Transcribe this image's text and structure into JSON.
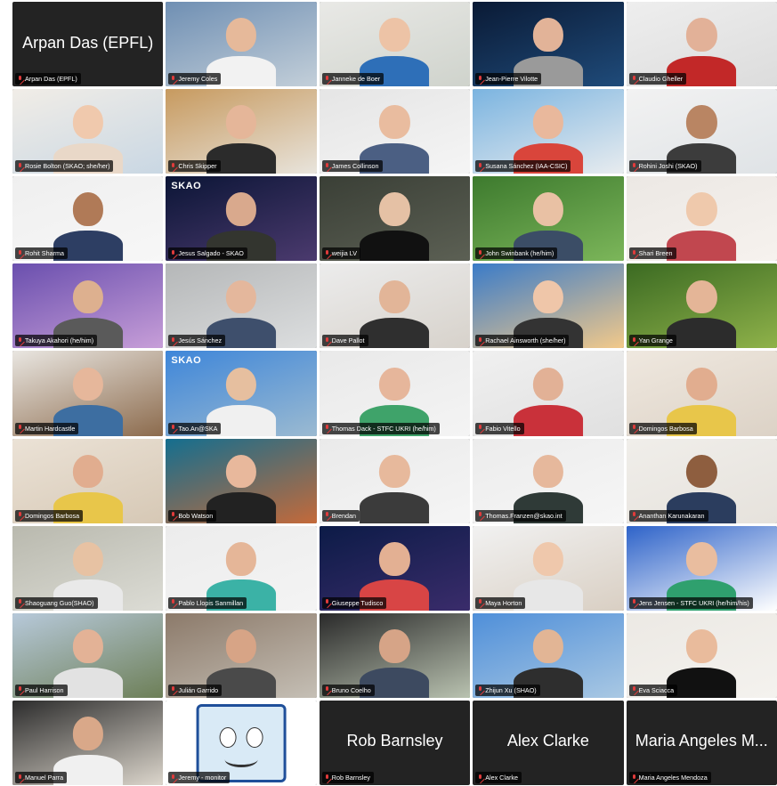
{
  "participants": [
    {
      "name": "Arpan Das (EPFL)",
      "video": false,
      "big_label": "Arpan Das (EPFL)",
      "muted": true
    },
    {
      "name": "Jeremy Coles",
      "video": true,
      "muted": true,
      "bg": [
        "#6f8fb3",
        "#c3cfd9"
      ],
      "skin": "#e6b99a",
      "shirt": "#f2f2f2"
    },
    {
      "name": "Janneke de Boer",
      "video": true,
      "muted": true,
      "bg": [
        "#e9e9e6",
        "#cfd3cc"
      ],
      "skin": "#edc3a6",
      "shirt": "#2e6fb8"
    },
    {
      "name": "Jean-Pierre Vilotte",
      "video": true,
      "muted": true,
      "bg": [
        "#0a1a35",
        "#1f4b7a"
      ],
      "skin": "#e2b398",
      "shirt": "#9a9a9a"
    },
    {
      "name": "Claudio Gheller",
      "video": true,
      "muted": true,
      "bg": [
        "#eeeeee",
        "#dcdcdc"
      ],
      "skin": "#e2b198",
      "shirt": "#c22828"
    },
    {
      "name": "Rosie Bolton (SKAO; she/her)",
      "video": true,
      "muted": true,
      "bg": [
        "#f1ede7",
        "#c9d7e3"
      ],
      "skin": "#f0c9ad",
      "shirt": "#e9d8c8"
    },
    {
      "name": "Chris Skipper",
      "video": true,
      "muted": true,
      "bg": [
        "#c79a5f",
        "#e8e4dc"
      ],
      "skin": "#e5b699",
      "shirt": "#2b2b2b"
    },
    {
      "name": "James Collinson",
      "video": true,
      "muted": true,
      "bg": [
        "#e5e5e5",
        "#f5f5f5"
      ],
      "skin": "#e9bc9f",
      "shirt": "#4b5f83"
    },
    {
      "name": "Susana Sánchez (IAA-CSIC)",
      "video": true,
      "muted": true,
      "bg": [
        "#7bb4e0",
        "#e8ecef"
      ],
      "skin": "#e9b89c",
      "shirt": "#d9453b"
    },
    {
      "name": "Rohini Joshi (SKAO)",
      "video": true,
      "muted": true,
      "bg": [
        "#f2f2f2",
        "#dfe3e6"
      ],
      "skin": "#b98563",
      "shirt": "#3c3c3c"
    },
    {
      "name": "Rohit Sharma",
      "video": true,
      "muted": true,
      "bg": [
        "#efefef",
        "#f7f7f7"
      ],
      "skin": "#b07a57",
      "shirt": "#2d3e63"
    },
    {
      "name": "Jesus Salgado - SKAO",
      "video": true,
      "muted": true,
      "bg": [
        "#0b1536",
        "#4b3a6e"
      ],
      "skin": "#d9a98d",
      "shirt": "#33352f",
      "overlay": "SKAO"
    },
    {
      "name": "weijia LV",
      "video": true,
      "muted": true,
      "bg": [
        "#3a3f36",
        "#5c6054"
      ],
      "skin": "#e5c1a5",
      "shirt": "#111111"
    },
    {
      "name": "John Swinbank (he/him)",
      "video": true,
      "muted": true,
      "bg": [
        "#3d7a2e",
        "#7cb65a"
      ],
      "skin": "#e9c1a4",
      "shirt": "#3b4d66"
    },
    {
      "name": "Shari Breen",
      "video": true,
      "muted": true,
      "bg": [
        "#ece8e4",
        "#f6f2ee"
      ],
      "skin": "#efc9ac",
      "shirt": "#c1474f"
    },
    {
      "name": "Takuya Akahori (he/him)",
      "video": true,
      "muted": true,
      "bg": [
        "#6a4fae",
        "#c79ed8"
      ],
      "skin": "#ddb08f",
      "shirt": "#5a5a5a"
    },
    {
      "name": "Jesús Sánchez",
      "video": true,
      "muted": true,
      "bg": [
        "#b5b7b8",
        "#dcdedf"
      ],
      "skin": "#e4b79c",
      "shirt": "#3e4f6c"
    },
    {
      "name": "Dave Pallot",
      "video": true,
      "muted": true,
      "bg": [
        "#ececec",
        "#d7d2cb"
      ],
      "skin": "#e2b598",
      "shirt": "#2f2f2f"
    },
    {
      "name": "Rachael Ainsworth (she/her)",
      "video": true,
      "muted": true,
      "bg": [
        "#3a7bc8",
        "#f2c98a"
      ],
      "skin": "#efc6a9",
      "shirt": "#333333"
    },
    {
      "name": "Yan Grange",
      "video": true,
      "muted": true,
      "bg": [
        "#3b6a22",
        "#8fb24a"
      ],
      "skin": "#e4b597",
      "shirt": "#2c2c2c"
    },
    {
      "name": "Martin Hardcastle",
      "video": true,
      "muted": true,
      "bg": [
        "#e9e6e1",
        "#8c6b4d"
      ],
      "skin": "#e6b79b",
      "shirt": "#3d6ea1"
    },
    {
      "name": "Tao.An@SKA",
      "video": true,
      "muted": true,
      "bg": [
        "#3e86d9",
        "#9bbad1"
      ],
      "skin": "#e6bf9f",
      "shirt": "#f0f0f0",
      "overlay": "SKAO"
    },
    {
      "name": "Thomas Dack - STFC UKRI (he/him)",
      "video": true,
      "muted": true,
      "bg": [
        "#e9e9e9",
        "#f4f4f4"
      ],
      "skin": "#e6b69b",
      "shirt": "#3fa36a"
    },
    {
      "name": "Fabio Vitello",
      "video": true,
      "muted": true,
      "bg": [
        "#f0f0f0",
        "#e0e0e0"
      ],
      "skin": "#e2b196",
      "shirt": "#c9313a"
    },
    {
      "name": "Domingos Barbosa",
      "video": true,
      "muted": true,
      "bg": [
        "#efe8df",
        "#dcd2c6"
      ],
      "skin": "#e1ad8f",
      "shirt": "#e8c64a"
    },
    {
      "name": "Domingos Barbosa",
      "video": true,
      "muted": true,
      "bg": [
        "#ebe2d6",
        "#d6c8b5"
      ],
      "skin": "#e1ad8f",
      "shirt": "#e8c64a"
    },
    {
      "name": "Bob Watson",
      "video": true,
      "muted": true,
      "bg": [
        "#146e8f",
        "#c46a3a"
      ],
      "skin": "#e8b89c",
      "shirt": "#222222"
    },
    {
      "name": "Brendan",
      "video": true,
      "muted": true,
      "bg": [
        "#eaeaea",
        "#f5f5f5"
      ],
      "skin": "#e7b99c",
      "shirt": "#3b3b3b"
    },
    {
      "name": "Thomas.Franzen@skao.int",
      "video": true,
      "muted": true,
      "bg": [
        "#ececec",
        "#f6f6f6"
      ],
      "skin": "#e6b89c",
      "shirt": "#2f3a37"
    },
    {
      "name": "Ananthan Karunakaran",
      "video": true,
      "muted": true,
      "bg": [
        "#f0eeea",
        "#e6e2dc"
      ],
      "skin": "#8e5e3f",
      "shirt": "#2b3d5e"
    },
    {
      "name": "Shaoguang Guo(SHAO)",
      "video": true,
      "muted": true,
      "bg": [
        "#b9b9ae",
        "#dcdcd5"
      ],
      "skin": "#e7c2a3",
      "shirt": "#e9e9e9"
    },
    {
      "name": "Pablo Llopis Sanmillan",
      "video": true,
      "muted": true,
      "bg": [
        "#ececec",
        "#f4f4f4"
      ],
      "skin": "#e5b698",
      "shirt": "#3bb2a6"
    },
    {
      "name": "Giuseppe Tudisco",
      "video": true,
      "muted": true,
      "bg": [
        "#0c1b47",
        "#3a2c6b"
      ],
      "skin": "#e3b093",
      "shirt": "#d84545"
    },
    {
      "name": "Maya Horton",
      "video": true,
      "muted": true,
      "bg": [
        "#f1f1f1",
        "#d9cfc3"
      ],
      "skin": "#efc8ac",
      "shirt": "#e7e7e7"
    },
    {
      "name": "Jens Jensen - STFC UKRI (he/him/his)",
      "video": true,
      "muted": true,
      "bg": [
        "#2e63c9",
        "#ffffff"
      ],
      "skin": "#e9bd9f",
      "shirt": "#2fa06e"
    },
    {
      "name": "Paul Harrison",
      "video": true,
      "muted": true,
      "bg": [
        "#b7c9da",
        "#6d7f57"
      ],
      "skin": "#e3b296",
      "shirt": "#e2e2e2"
    },
    {
      "name": "Julián Garrido",
      "video": true,
      "muted": true,
      "bg": [
        "#8c7a6a",
        "#c5bfb5"
      ],
      "skin": "#d7a486",
      "shirt": "#4a4a4a"
    },
    {
      "name": "Bruno Coelho",
      "video": true,
      "muted": true,
      "active": true,
      "bg": [
        "#2a2a2a",
        "#b9c2b0"
      ],
      "skin": "#d6a487",
      "shirt": "#3d4a60"
    },
    {
      "name": "Zhijun Xu (SHAO)",
      "video": true,
      "muted": true,
      "bg": [
        "#4f8fd9",
        "#a9c8e3"
      ],
      "skin": "#e2b595",
      "shirt": "#2e2e2e"
    },
    {
      "name": "Eva Sciacca",
      "video": true,
      "muted": true,
      "bg": [
        "#ece9e4",
        "#f4f2ee"
      ],
      "skin": "#e9bb9c",
      "shirt": "#111111"
    },
    {
      "name": "Manuel Parra",
      "video": true,
      "muted": true,
      "bg": [
        "#2c2c2c",
        "#dcd6cc"
      ],
      "skin": "#d9a889",
      "shirt": "#f0f0f0"
    },
    {
      "name": "Jeremy - monitor",
      "video": true,
      "muted": true,
      "cartoon": true,
      "bg": [
        "#ffffff",
        "#ffffff"
      ]
    },
    {
      "name": "Rob Barnsley",
      "video": false,
      "big_label": "Rob Barnsley",
      "muted": true
    },
    {
      "name": "Alex Clarke",
      "video": false,
      "big_label": "Alex Clarke",
      "muted": true
    },
    {
      "name": "Maria Angeles Mendoza",
      "video": false,
      "big_label": "Maria Angeles M...",
      "muted": true
    }
  ]
}
